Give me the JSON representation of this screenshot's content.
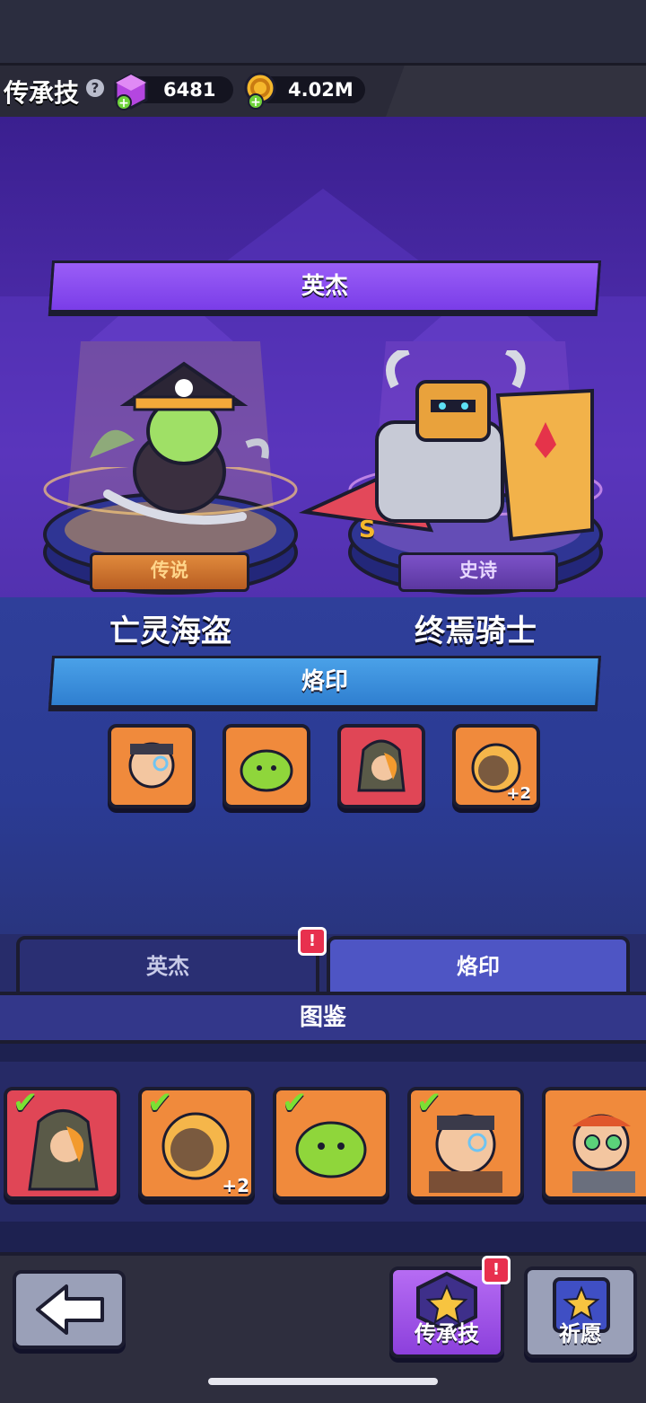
{
  "header": {
    "title": "传承技",
    "help_icon": "?",
    "gems": "6481",
    "coins": "4.02M"
  },
  "banners": {
    "heroes": "英杰",
    "brands": "烙印",
    "collection": "图鉴"
  },
  "heroes": [
    {
      "name": "亡灵海盗",
      "rarity": "传说"
    },
    {
      "name": "终焉骑士",
      "rarity": "史诗",
      "badge": "S"
    }
  ],
  "brand_slots": [
    {
      "label": "",
      "color": "#f08a3c"
    },
    {
      "label": "",
      "color": "#f08a3c"
    },
    {
      "label": "",
      "color": "#e04656"
    },
    {
      "label": "+2",
      "color": "#f08a3c"
    }
  ],
  "tabs": {
    "heroes": "英杰",
    "brands": "烙印",
    "alert": "!"
  },
  "collection_cards": [
    {
      "label": "",
      "checked": true,
      "color": "#e04656"
    },
    {
      "label": "+2",
      "checked": true,
      "color": "#f08a3c"
    },
    {
      "label": "",
      "checked": true,
      "color": "#f08a3c"
    },
    {
      "label": "",
      "checked": true,
      "color": "#f08a3c"
    },
    {
      "label": "",
      "checked": false,
      "color": "#f08a3c"
    }
  ],
  "bottom": {
    "inherit_label": "传承技",
    "wish_label": "祈愿",
    "alert": "!"
  }
}
